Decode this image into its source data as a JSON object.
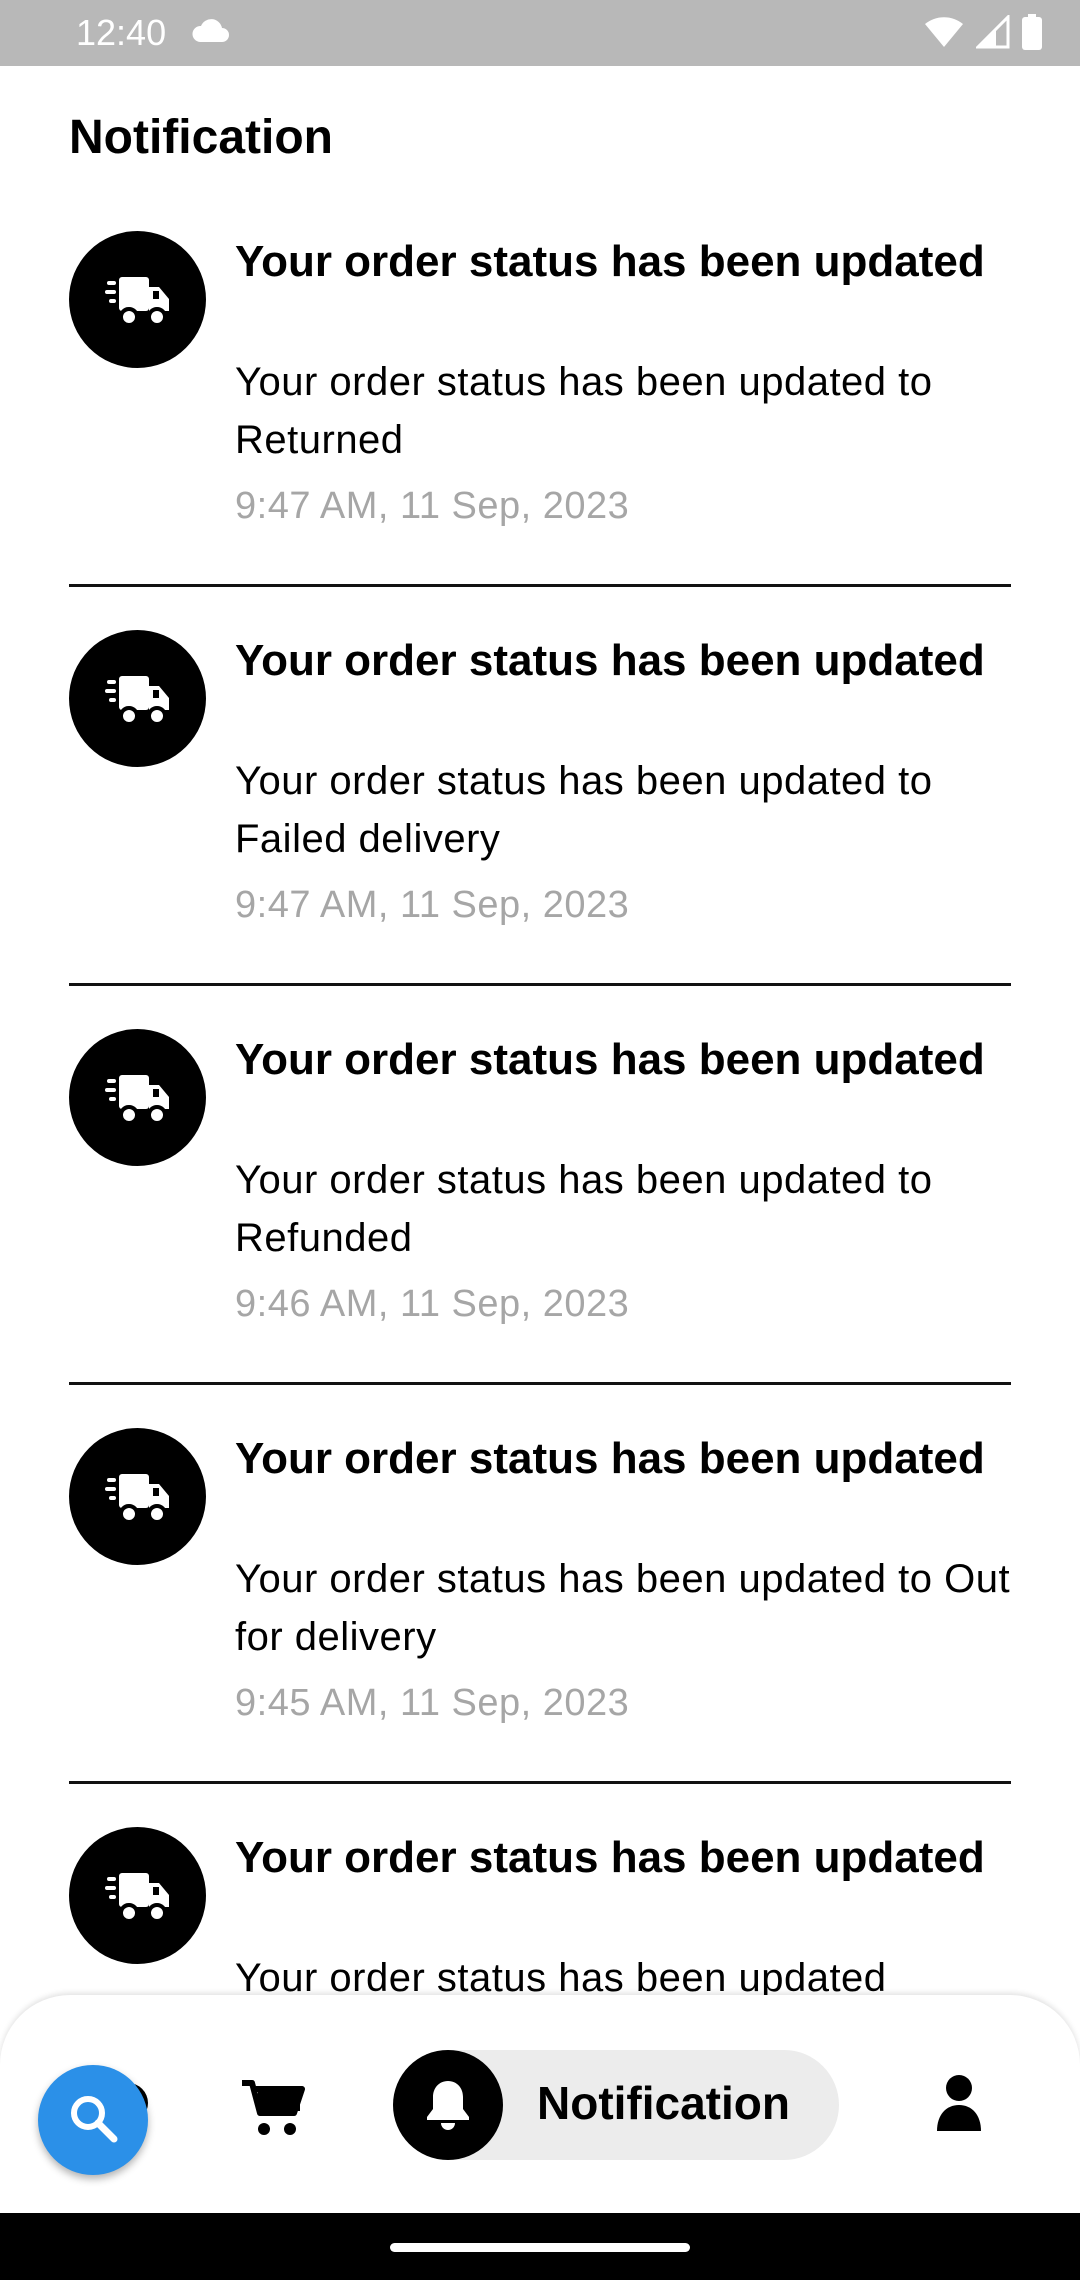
{
  "status_bar": {
    "time": "12:40"
  },
  "page": {
    "title": "Notification"
  },
  "notifications": [
    {
      "title": "Your order status has been updated",
      "body": "Your order status has been updated to Returned",
      "time": "9:47 AM, 11 Sep, 2023"
    },
    {
      "title": "Your order status has been updated",
      "body": "Your order status has been updated to Failed delivery",
      "time": "9:47 AM, 11 Sep, 2023"
    },
    {
      "title": "Your order status has been updated",
      "body": "Your order status has been updated to Refunded",
      "time": "9:46 AM, 11 Sep, 2023"
    },
    {
      "title": "Your order status has been updated",
      "body": "Your order status has been updated to Out for delivery",
      "time": "9:45 AM, 11 Sep, 2023"
    },
    {
      "title": "Your order status has been updated",
      "body": "Your order status has been updated",
      "time": ""
    }
  ],
  "bottom_nav": {
    "active_label": "Notification",
    "icons": [
      "home-icon",
      "search-icon",
      "cart-icon",
      "bell-icon",
      "profile-icon"
    ],
    "accent_color": "#2b90e8"
  }
}
